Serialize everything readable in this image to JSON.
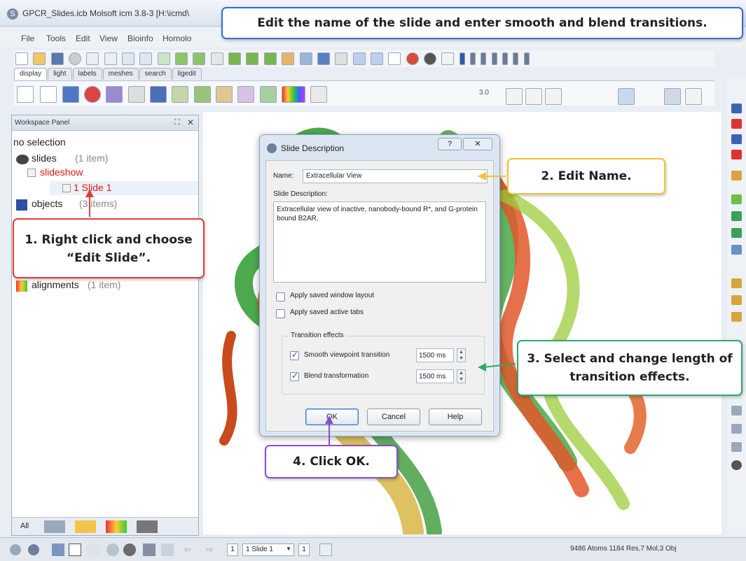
{
  "window": {
    "title": "GPCR_Slides.icb Molsoft icm 3.8-3  [H:\\icmd\\"
  },
  "menu": [
    "File",
    "Tools",
    "Edit",
    "View",
    "Bioinfo",
    "Homolo"
  ],
  "tabs": [
    "display",
    "light",
    "labels",
    "meshes",
    "search",
    "ligedit"
  ],
  "toolbar": {
    "label_value": "3.0"
  },
  "panel": {
    "title": "Workspace Panel",
    "selection": "no selection",
    "tree": {
      "slides": "slides",
      "slides_count": "(1 item)",
      "slideshow": "slideshow",
      "slide1": "1 Slide 1",
      "objects": "objects",
      "objects_count": "(3 items)",
      "alignments": "alignments",
      "alignments_count": "(1 item)"
    },
    "bottom_tab": "All"
  },
  "dialog": {
    "title": "Slide Description",
    "help_glyph": "?",
    "name_label": "Name:",
    "name_value": "Extracellular View",
    "desc_label": "Slide Description:",
    "desc_text": "Extracellular view of inactive, nanobody-bound R*, and G-protein bound B2AR.",
    "opt_layout": "Apply saved window layout",
    "opt_tabs": "Apply saved active tabs",
    "group_title": "Transition effects",
    "smooth_label": "Smooth viewpoint transition",
    "smooth_value": "1500 ms",
    "blend_label": "Blend transformation",
    "blend_value": "1500 ms",
    "ok": "OK",
    "cancel": "Cancel",
    "help": "Help"
  },
  "status": {
    "page_left": "1",
    "slide_select": "1 Slide 1",
    "page_right": "1",
    "info": "9486 Atoms 1184 Res,7 Mol,3 Obj"
  },
  "callouts": {
    "top": "Edit the name of the slide and enter smooth and blend transitions.",
    "step1": "1. Right click and choose “Edit Slide”.",
    "step2": "2. Edit Name.",
    "step3": "3. Select and change length of transition effects.",
    "step4": "4. Click OK."
  },
  "colors": {
    "callout_blue": "#2f6fd8",
    "callout_red": "#e23c3c",
    "callout_yellow": "#f2c230",
    "callout_green": "#2fa86a",
    "callout_purple": "#8a4fc8",
    "tree_red": "#e01616"
  }
}
